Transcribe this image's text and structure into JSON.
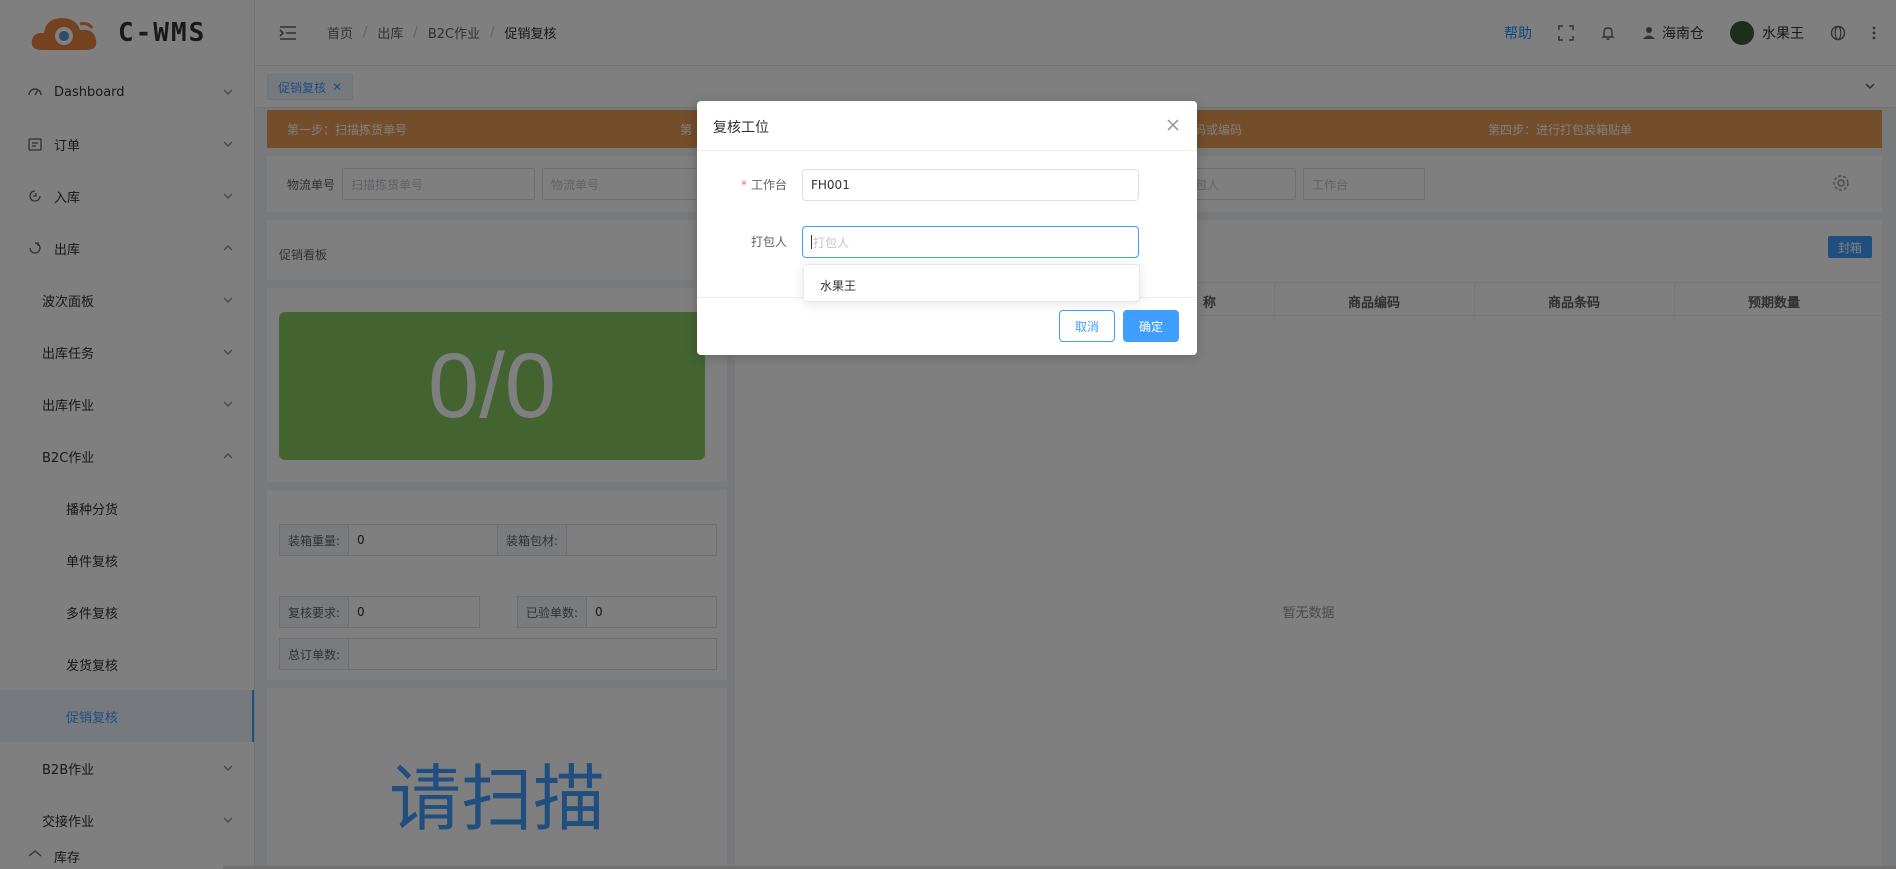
{
  "app": {
    "logo_text": "C-WMS"
  },
  "sidebar": {
    "items": [
      {
        "label": "Dashboard",
        "icon": "dashboard-icon",
        "level": 0,
        "expanded": false
      },
      {
        "label": "订单",
        "icon": "order-icon",
        "level": 0,
        "expanded": false
      },
      {
        "label": "入库",
        "icon": "inbound-icon",
        "level": 0,
        "expanded": false
      },
      {
        "label": "出库",
        "icon": "outbound-icon",
        "level": 0,
        "expanded": true
      },
      {
        "label": "波次面板",
        "level": 1,
        "expanded": false
      },
      {
        "label": "出库任务",
        "level": 1,
        "expanded": false
      },
      {
        "label": "出库作业",
        "level": 1,
        "expanded": false
      },
      {
        "label": "B2C作业",
        "level": 1,
        "expanded": true
      },
      {
        "label": "播种分货",
        "level": 2
      },
      {
        "label": "单件复核",
        "level": 2
      },
      {
        "label": "多件复核",
        "level": 2
      },
      {
        "label": "发货复核",
        "level": 2
      },
      {
        "label": "促销复核",
        "level": 2,
        "active": true
      },
      {
        "label": "B2B作业",
        "level": 1,
        "expanded": false
      },
      {
        "label": "交接作业",
        "level": 1,
        "expanded": false
      },
      {
        "label": "库存",
        "level": 0,
        "partial": true
      }
    ]
  },
  "header": {
    "breadcrumb": [
      "首页",
      "出库",
      "B2C作业",
      "促销复核"
    ],
    "help": "帮助",
    "warehouse": "海南仓",
    "user": "水果王"
  },
  "tabs": {
    "active_tab": "促销复核"
  },
  "steps": {
    "step1": "第一步：扫描拣货单号",
    "step2": "第",
    "step3": "码或编码",
    "step4": "第四步：进行打包装箱贴单"
  },
  "search": {
    "label": "物流单号",
    "placeholder1": "扫描拣货单号",
    "placeholder2": "物流单号",
    "placeholder3": "包人",
    "placeholder4": "工作台"
  },
  "board": {
    "title": "促销看板",
    "score": "0/0",
    "weight_label": "装箱重量:",
    "weight_value": "0",
    "material_label": "装箱包材:",
    "material_value": "",
    "review_req_label": "复核要求:",
    "review_req_value": "0",
    "checked_label": "已验单数:",
    "checked_value": "0",
    "total_label": "总订单数:",
    "total_value": "",
    "scan_prompt": "请扫描"
  },
  "table": {
    "seal_button": "封箱",
    "columns": [
      "称",
      "商品编码",
      "商品条码",
      "预期数量"
    ],
    "empty": "暂无数据"
  },
  "dialog": {
    "title": "复核工位",
    "workstation_label": "工作台",
    "workstation_value": "FH001",
    "packer_label": "打包人",
    "packer_placeholder": "打包人",
    "dropdown_option": "水果王",
    "cancel": "取消",
    "confirm": "确定"
  },
  "colors": {
    "primary": "#409eff",
    "banner": "#e89a55",
    "score_bg": "#87c763",
    "required": "#f56c6c"
  }
}
